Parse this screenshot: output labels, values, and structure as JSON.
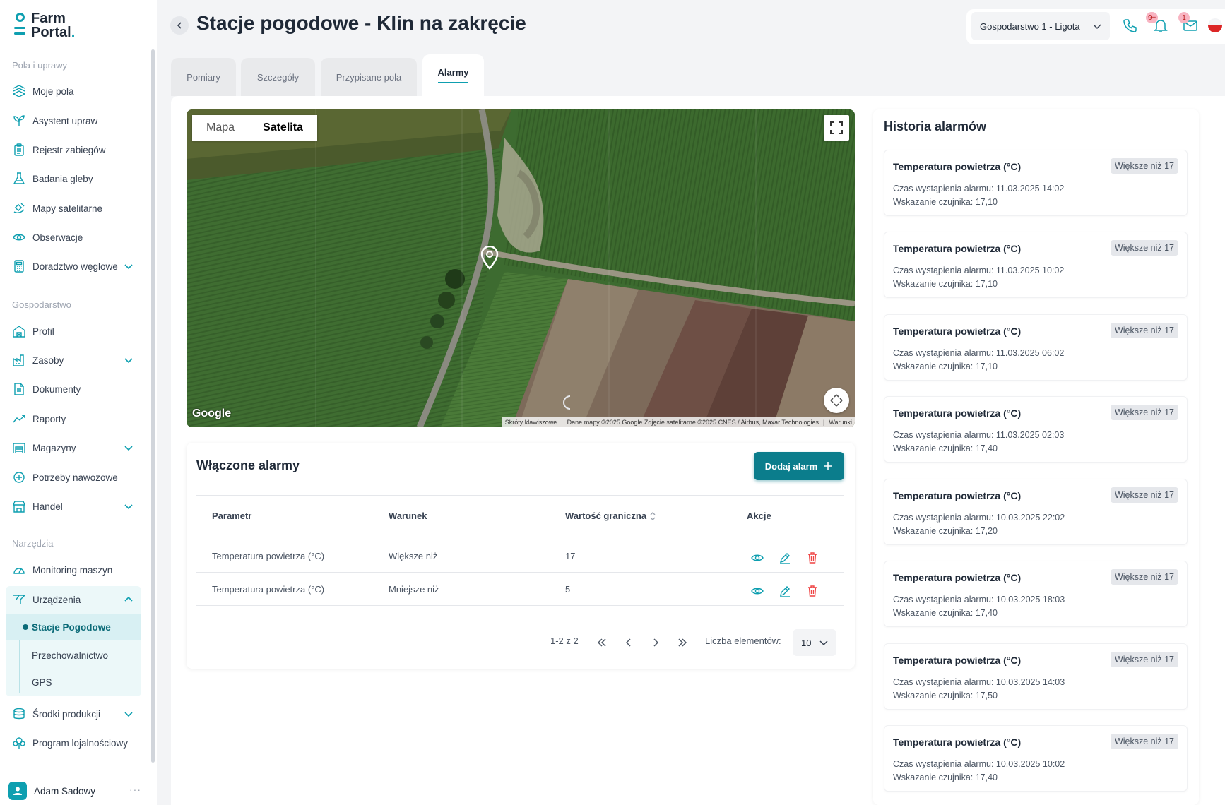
{
  "brand": {
    "line1": "Farm",
    "line2": "Portal",
    "dot": "."
  },
  "sidebar": {
    "sections": [
      {
        "label": "Pola i uprawy"
      },
      {
        "label": "Gospodarstwo"
      },
      {
        "label": "Narzędzia"
      }
    ],
    "items": [
      {
        "label": "Moje pola",
        "icon": "field-icon"
      },
      {
        "label": "Asystent upraw",
        "icon": "sprout-icon"
      },
      {
        "label": "Rejestr zabiegów",
        "icon": "clipboard-icon"
      },
      {
        "label": "Badania gleby",
        "icon": "flask-icon"
      },
      {
        "label": "Mapy satelitarne",
        "icon": "satellite-icon"
      },
      {
        "label": "Obserwacje",
        "icon": "eye-icon"
      },
      {
        "label": "Doradztwo węglowe",
        "icon": "calculator-icon"
      },
      {
        "label": "Profil",
        "icon": "barn-icon"
      },
      {
        "label": "Zasoby",
        "icon": "factory-icon"
      },
      {
        "label": "Dokumenty",
        "icon": "document-icon"
      },
      {
        "label": "Raporty",
        "icon": "trend-icon"
      },
      {
        "label": "Magazyny",
        "icon": "warehouse-icon"
      },
      {
        "label": "Potrzeby nawozowe",
        "icon": "leaf-icon"
      },
      {
        "label": "Handel",
        "icon": "store-icon"
      },
      {
        "label": "Monitoring maszyn",
        "icon": "gauge-icon"
      },
      {
        "label": "Urządzenia",
        "icon": "antenna-icon"
      },
      {
        "label": "Środki produkcji",
        "icon": "database-icon"
      },
      {
        "label": "Program lojalnościowy",
        "icon": "tree-icon"
      }
    ],
    "sub_items": [
      {
        "label": "Stacje Pogodowe"
      },
      {
        "label": "Przechowalnictwo"
      },
      {
        "label": "GPS"
      }
    ],
    "user": {
      "name": "Adam Sadowy",
      "menu": "···"
    }
  },
  "header": {
    "title": "Stacje pogodowe - Klin na zakręcie",
    "farm": "Gospodarstwo 1 - Ligota",
    "notifications_badge": "9+",
    "messages_badge": "1"
  },
  "tabs": [
    {
      "label": "Pomiary"
    },
    {
      "label": "Szczegóły"
    },
    {
      "label": "Przypisane pola"
    },
    {
      "label": "Alarmy"
    }
  ],
  "map": {
    "mode_map": "Mapa",
    "mode_satellite": "Satelita",
    "logo": "Google",
    "attribution": {
      "shortcuts": "Skróty klawiszowe",
      "data": "Dane mapy ©2025 Google Zdjęcie satelitarne ©2025 CNES / Airbus, Maxar Technologies",
      "terms": "Warunki"
    }
  },
  "alarms": {
    "title": "Włączone alarmy",
    "add_button": "Dodaj alarm",
    "columns": [
      "Parametr",
      "Warunek",
      "Wartość graniczna",
      "Akcje"
    ],
    "rows": [
      {
        "parameter": "Temperatura powietrza (°C)",
        "condition": "Większe niż",
        "threshold": "17"
      },
      {
        "parameter": "Temperatura powietrza (°C)",
        "condition": "Mniejsze niż",
        "threshold": "5"
      }
    ],
    "pagination": {
      "range": "1-2 z 2",
      "per_page_label": "Liczba elementów:",
      "per_page": "10"
    }
  },
  "history": {
    "title": "Historia alarmów",
    "items": [
      {
        "title": "Temperatura powietrza (°C)",
        "tag": "Większe niż 17",
        "time": "Czas wystąpienia alarmu: 11.03.2025 14:02",
        "reading": "Wskazanie czujnika: 17,10"
      },
      {
        "title": "Temperatura powietrza (°C)",
        "tag": "Większe niż 17",
        "time": "Czas wystąpienia alarmu: 11.03.2025 10:02",
        "reading": "Wskazanie czujnika: 17,10"
      },
      {
        "title": "Temperatura powietrza (°C)",
        "tag": "Większe niż 17",
        "time": "Czas wystąpienia alarmu: 11.03.2025 06:02",
        "reading": "Wskazanie czujnika: 17,10"
      },
      {
        "title": "Temperatura powietrza (°C)",
        "tag": "Większe niż 17",
        "time": "Czas wystąpienia alarmu: 11.03.2025 02:03",
        "reading": "Wskazanie czujnika: 17,40"
      },
      {
        "title": "Temperatura powietrza (°C)",
        "tag": "Większe niż 17",
        "time": "Czas wystąpienia alarmu: 10.03.2025 22:02",
        "reading": "Wskazanie czujnika: 17,20"
      },
      {
        "title": "Temperatura powietrza (°C)",
        "tag": "Większe niż 17",
        "time": "Czas wystąpienia alarmu: 10.03.2025 18:03",
        "reading": "Wskazanie czujnika: 17,40"
      },
      {
        "title": "Temperatura powietrza (°C)",
        "tag": "Większe niż 17",
        "time": "Czas wystąpienia alarmu: 10.03.2025 14:03",
        "reading": "Wskazanie czujnika: 17,50"
      },
      {
        "title": "Temperatura powietrza (°C)",
        "tag": "Większe niż 17",
        "time": "Czas wystąpienia alarmu: 10.03.2025 10:02",
        "reading": "Wskazanie czujnika: 17,40"
      }
    ]
  },
  "colors": {
    "accent": "#0e9fb0",
    "primary_button": "#0b7d8c",
    "danger": "#ef4444"
  }
}
